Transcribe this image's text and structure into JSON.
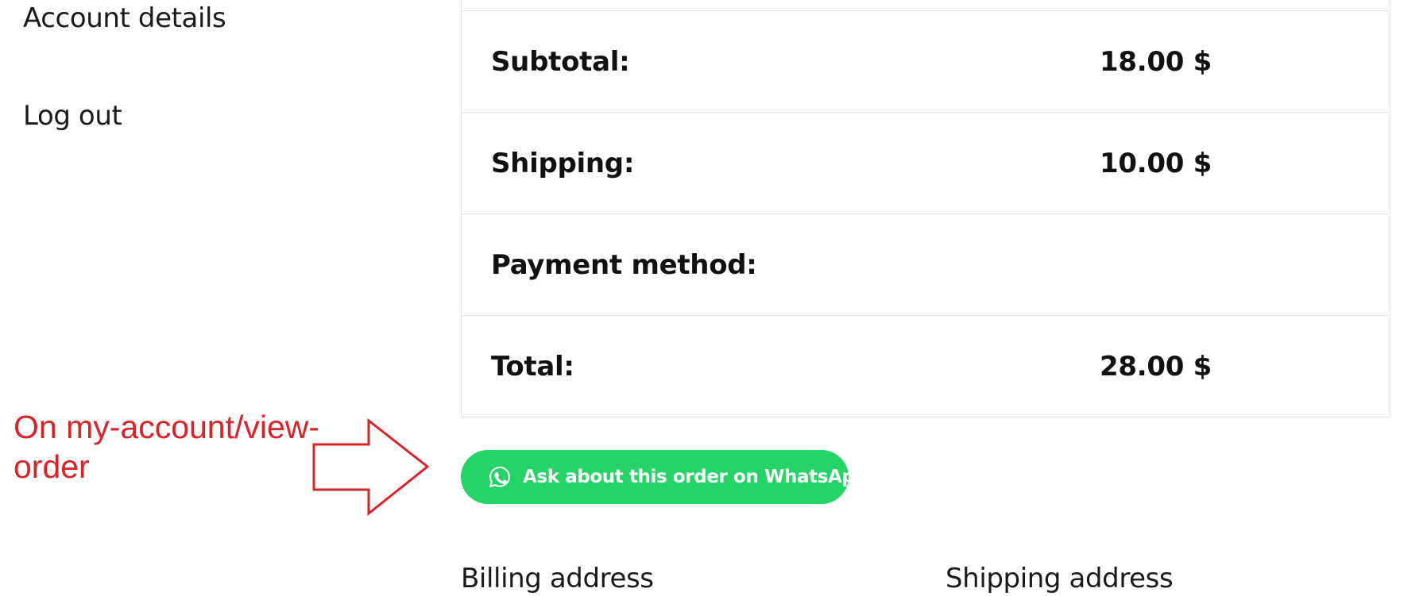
{
  "account_nav": {
    "items": [
      {
        "label": "Account details"
      },
      {
        "label": "Log out"
      }
    ]
  },
  "order_totals": {
    "rows": [
      {
        "label": "Subtotal:",
        "value": "18.00 $"
      },
      {
        "label": "Shipping:",
        "value": "10.00 $"
      },
      {
        "label": "Payment method:",
        "value": ""
      },
      {
        "label": "Total:",
        "value": "28.00 $"
      }
    ]
  },
  "whatsapp_button": {
    "label": "Ask about this order on WhatsApp",
    "icon": "whatsapp-icon",
    "color": "#25d366"
  },
  "annotation": {
    "text": "On my-account/view-order",
    "color": "#d8232a"
  },
  "addresses": {
    "billing_heading": "Billing address",
    "shipping_heading": "Shipping address"
  }
}
